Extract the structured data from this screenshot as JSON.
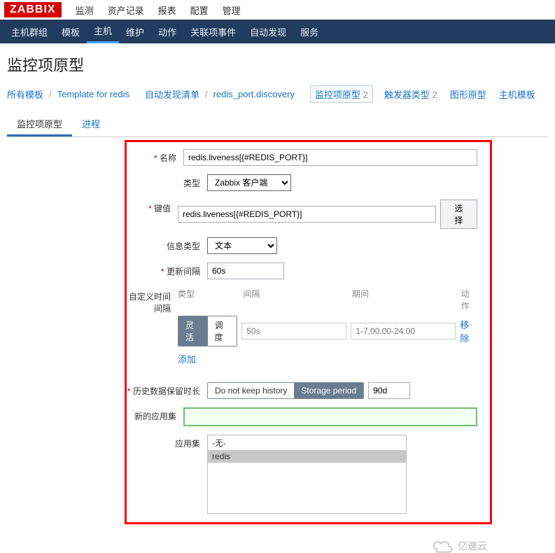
{
  "logo": "ZABBIX",
  "topmenu": [
    "监测",
    "资产记录",
    "报表",
    "配置",
    "管理"
  ],
  "secondmenu": [
    "主机群组",
    "模板",
    "主机",
    "维护",
    "动作",
    "关联项事件",
    "自动发现",
    "服务"
  ],
  "page_title": "监控项原型",
  "breadcrumb": {
    "b1": "所有模板",
    "b2": "Template for redis",
    "b3": "自动发现清单",
    "b4": "redis_port.discovery",
    "g1": "监控项原型",
    "c1": "2",
    "g2": "触发器类型",
    "c2": "2",
    "g3": "图形原型",
    "g4": "主机模板"
  },
  "subtabs": {
    "t1": "监控项原型",
    "t2": "进程"
  },
  "labels": {
    "name": "名称",
    "type": "类型",
    "key": "键值",
    "info": "信息类型",
    "interval": "更新间隔",
    "custom": "自定义时间间隔",
    "history": "历史数据保留时长",
    "newapp": "新的应用集",
    "appset": "应用集"
  },
  "fields": {
    "name_val": "redis.liveness[{#REDIS_PORT}]",
    "type_val": "Zabbix 客户端",
    "key_val": "redis.liveness[{#REDIS_PORT}]",
    "select_btn": "选择",
    "info_val": "文本",
    "interval_val": "60s"
  },
  "custom_int": {
    "h_type": "类型",
    "h_int": "间隔",
    "h_period": "期间",
    "h_act": "动作",
    "seg_on": "灵活",
    "seg_off": "调度",
    "int_ph": "50s",
    "period_ph": "1-7,00:00-24:00",
    "add": "添加",
    "remove": "移除"
  },
  "history": {
    "seg_off": "Do not keep history",
    "seg_on": "Storage period",
    "val": "90d"
  },
  "appset": {
    "none": "-无-",
    "redis": "redis"
  },
  "watermark": "亿速云"
}
